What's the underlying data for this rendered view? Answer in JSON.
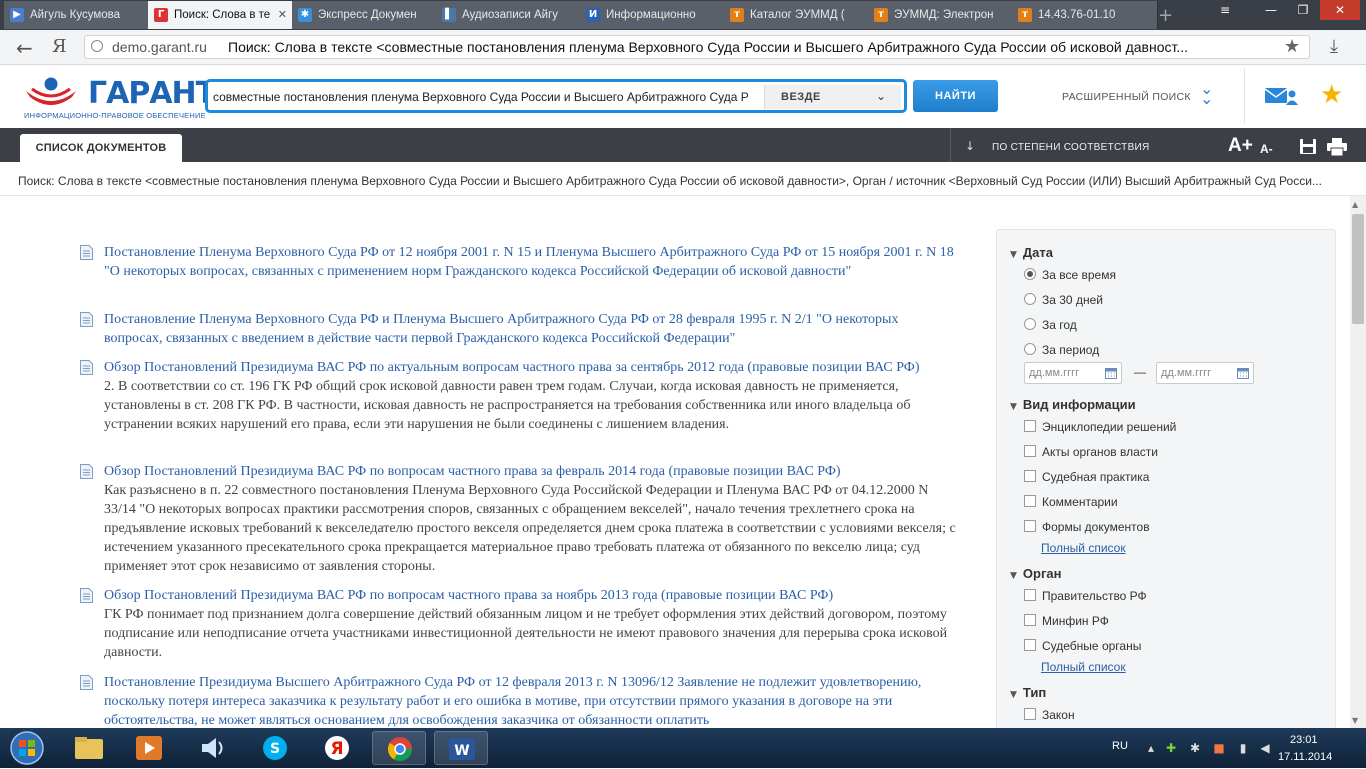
{
  "browser": {
    "tabs": [
      {
        "title": "Айгуль Кусумова",
        "color": "#4a7ccc",
        "glyph": "▶",
        "active": false
      },
      {
        "title": "Поиск: Слова в те",
        "color": "#d33",
        "glyph": "Г",
        "active": true
      },
      {
        "title": "Экспресс Докумен",
        "color": "#3b8ed8",
        "glyph": "✱",
        "active": false
      },
      {
        "title": "Аудиозаписи Айгу",
        "color": "#4a76a8",
        "glyph": "▌",
        "active": false
      },
      {
        "title": "Информационно",
        "color": "#2a63b0",
        "glyph": "И",
        "active": false
      },
      {
        "title": "Каталог ЭУММД (",
        "color": "#e0801a",
        "glyph": "т",
        "active": false
      },
      {
        "title": "ЭУММД: Электрон",
        "color": "#e0801a",
        "glyph": "т",
        "active": false
      },
      {
        "title": "14.43.76-01.10",
        "color": "#e0801a",
        "glyph": "т",
        "active": false
      }
    ],
    "address": {
      "domain": "demo.garant.ru",
      "title": "Поиск: Слова в тексте <совместные постановления пленума Верховного Суда России и Высшего Арбитражного Суда России об исковой давност..."
    },
    "back_glyph": "←",
    "ya_glyph": "Я"
  },
  "header": {
    "logo": "ГАРАНТ",
    "logo_sub": "ИНФОРМАЦИОННО-ПРАВОВОЕ ОБЕСПЕЧЕНИЕ",
    "search_value": "совместные постановления пленума Верховного Суда России и Высшего Арбитражного Суда Р",
    "scope": "ВЕЗДЕ",
    "find_label": "НАЙТИ",
    "advanced_label": "РАСШИРЕННЫЙ ПОИСК"
  },
  "toolbar": {
    "tab_label": "СПИСОК ДОКУМЕНТОВ",
    "sort_label": "ПО СТЕПЕНИ СООТВЕТСТВИЯ",
    "font_inc": "A+",
    "font_dec": "A-"
  },
  "breadcrumb": "Поиск: Слова в тексте <совместные постановления пленума Верховного Суда России и Высшего Арбитражного Суда России об исковой давности>, Орган / источник <Верховный Суд России (ИЛИ) Высший Арбитражный Суд Росси...",
  "results": [
    {
      "title": "Постановление Пленума Верховного Суда РФ от 12 ноября 2001 г. N 15 и Пленума Высшего Арбитражного Суда РФ от 15 ноября 2001 г. N 18 \"О некоторых вопросах, связанных с применением норм Гражданского кодекса Российской Федерации об исковой давности\"",
      "snippet": ""
    },
    {
      "title": "Постановление Пленума Верховного Суда РФ и Пленума Высшего Арбитражного Суда РФ от 28 февраля 1995 г. N 2/1 \"О некоторых вопросах, связанных с введением в действие части первой Гражданского кодекса Российской Федерации\"",
      "snippet": ""
    },
    {
      "title": "Обзор Постановлений Президиума ВАС РФ по актуальным вопросам частного права за сентябрь 2012 года (правовые позиции ВАС РФ)",
      "snippet": "2. В соответствии со ст. 196 ГК РФ общий срок исковой давности равен трем годам. Случаи, когда исковая давность не применяется, установлены в ст. 208 ГК РФ. В частности, исковая давность не распространяется на требования собственника или иного владельца об устранении всяких нарушений его права, если эти нарушения не были соединены с лишением владения."
    },
    {
      "title": "Обзор Постановлений Президиума ВАС РФ по вопросам частного права за февраль 2014 года (правовые позиции ВАС РФ)",
      "snippet": "Как разъяснено в п. 22 совместного постановления Пленума Верховного Суда Российской Федерации и Пленума ВАС РФ от 04.12.2000 N 33/14 \"О некоторых вопросах практики рассмотрения споров, связанных с обращением векселей\", начало течения трехлетнего срока на предъявление исковых требований к векселедателю простого векселя определяется днем срока платежа в соответствии с условиями векселя; с истечением указанного пресекательного срока прекращается материальное право требовать платежа от обязанного по векселю лица; суд применяет этот срок независимо от заявления стороны."
    },
    {
      "title": "Обзор Постановлений Президиума ВАС РФ по вопросам частного права за ноябрь 2013 года (правовые позиции ВАС РФ)",
      "snippet": "ГК РФ понимает под признанием долга совершение действий обязанным лицом и не требует оформления этих действий договором, поэтому подписание или неподписание отчета участниками инвестиционной деятельности не имеют правового значения для перерыва срока исковой давности."
    },
    {
      "title": "Постановление Президиума Высшего Арбитражного Суда РФ от 12 февраля 2013 г. N 13096/12 Заявление не подлежит удовлетворению, поскольку потеря интереса заказчика к результату работ и его ошибка в мотиве, при отсутствии прямого указания в договоре на эти обстоятельства, не может являться основанием для освобождения заказчика от обязанности оплатить",
      "snippet": ""
    }
  ],
  "filters": {
    "date": {
      "heading": "Дата",
      "options": [
        "За все время",
        "За 30 дней",
        "За год",
        "За период"
      ],
      "selected": 0,
      "from_placeholder": "дд.мм.гггг",
      "to_placeholder": "дд.мм.гггг",
      "dash": "—"
    },
    "info_type": {
      "heading": "Вид информации",
      "options": [
        "Энциклопедии решений",
        "Акты органов власти",
        "Судебная практика",
        "Комментарии",
        "Формы документов"
      ],
      "more": "Полный список"
    },
    "organ": {
      "heading": "Орган",
      "options": [
        "Правительство РФ",
        "Минфин РФ",
        "Судебные органы"
      ],
      "more": "Полный список"
    },
    "type": {
      "heading": "Тип",
      "options": [
        "Закон"
      ]
    }
  },
  "taskbar": {
    "lang": "RU",
    "time": "23:01",
    "date": "17.11.2014"
  }
}
